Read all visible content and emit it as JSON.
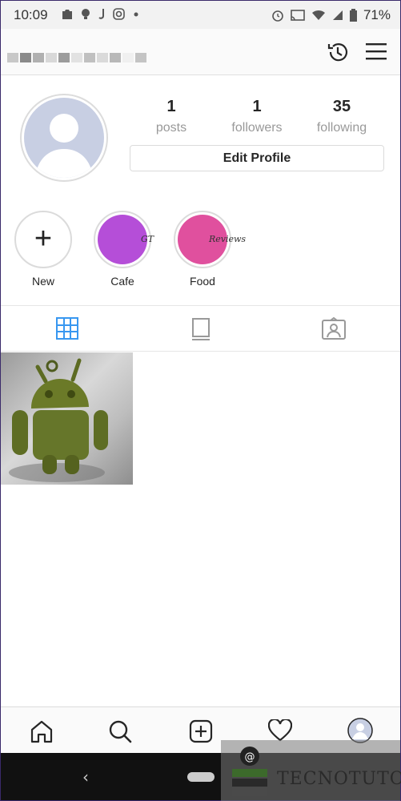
{
  "status_bar": {
    "time": "10:09",
    "battery": "71%",
    "left_icons": [
      "photo-icon",
      "bulb-icon",
      "j-icon",
      "instagram-icon",
      "dot-icon"
    ],
    "right_icons": [
      "alarm-icon",
      "cast-icon",
      "wifi-icon",
      "signal-icon",
      "battery-icon"
    ]
  },
  "header": {
    "username_redacted": true
  },
  "profile": {
    "stats": [
      {
        "num": "1",
        "label": "posts"
      },
      {
        "num": "1",
        "label": "followers"
      },
      {
        "num": "35",
        "label": "following"
      }
    ],
    "edit_button": "Edit Profile"
  },
  "highlights": [
    {
      "label": "New",
      "type": "new"
    },
    {
      "label": "Cafe",
      "inner_text": "GT",
      "color": "#b54ed8"
    },
    {
      "label": "Food",
      "inner_text": "Reviews",
      "color": "#e0509e"
    }
  ],
  "tabs": [
    "grid-icon",
    "igtv-icon",
    "tagged-icon"
  ],
  "grid": {
    "posts": [
      "android-figure-photo"
    ]
  },
  "bottom_nav": [
    "home-icon",
    "search-icon",
    "add-post-icon",
    "heart-icon",
    "profile-avatar-icon"
  ],
  "watermark": {
    "text": "TECNOTUTO"
  },
  "colors": {
    "active_tab": "#3897f0",
    "text_primary": "#262626",
    "text_secondary": "#999999"
  }
}
